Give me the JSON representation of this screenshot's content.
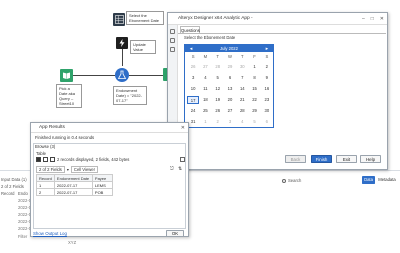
{
  "canvas": {
    "annotations": {
      "select_date": "Select the Ebonement Date",
      "update_value": "Update Value",
      "pick_date": "Pick a Date aka Query – Street10",
      "endowment": "Endowment Date) = \"2022-07-17\""
    }
  },
  "app_window": {
    "title": "Alteryx Designer x64 Analytic App -",
    "tab": "Questions",
    "question_label": "Select the Ebonement Date",
    "calendar": {
      "month_label": "July 2022",
      "prev": "◄",
      "next": "►",
      "dows": [
        "S",
        "M",
        "T",
        "W",
        "T",
        "F",
        "S"
      ],
      "rows": [
        [
          "26",
          "27",
          "28",
          "29",
          "30",
          "1",
          "2"
        ],
        [
          "3",
          "4",
          "5",
          "6",
          "7",
          "8",
          "9"
        ],
        [
          "10",
          "11",
          "12",
          "13",
          "14",
          "15",
          "16"
        ],
        [
          "17",
          "18",
          "19",
          "20",
          "21",
          "22",
          "23"
        ],
        [
          "24",
          "25",
          "26",
          "27",
          "28",
          "29",
          "30"
        ],
        [
          "31",
          "1",
          "2",
          "3",
          "4",
          "5",
          "6"
        ]
      ],
      "selected": "17"
    },
    "buttons": {
      "back": "Back",
      "finish": "Finish",
      "exit": "Exit",
      "help": "Help"
    }
  },
  "results_window": {
    "title": "App Results",
    "status": "Finished running in 0.4 seconds",
    "browse_label": "Browse (3)",
    "table_label": "Table",
    "record_info": "2 records displayed, 2 fields, 442 bytes",
    "fields_label": "2 of 2 Fields",
    "cell_viewer": "Cell Viewer",
    "columns": [
      "Record",
      "Endonement Date",
      "Payee"
    ],
    "rows": [
      [
        "1",
        "2022-07-17",
        "LEMS"
      ],
      [
        "2",
        "2022-07-17",
        "POB"
      ]
    ],
    "show_log": "Show Output Log",
    "ok": "OK"
  },
  "results_pane": {
    "input_label": "Input Data (1)",
    "fields_label": "2 of 2 Fields",
    "search_placeholder": "Search",
    "data_tab": "Data",
    "metadata_tab": "Metadata",
    "col_record": "Record",
    "col_endo": "Endo",
    "rows": [
      "2022-0",
      "2022-0",
      "2022-0",
      "2022-0",
      "2022-0"
    ],
    "filter_label": "Filter",
    "fmt_value": "XYZ"
  }
}
